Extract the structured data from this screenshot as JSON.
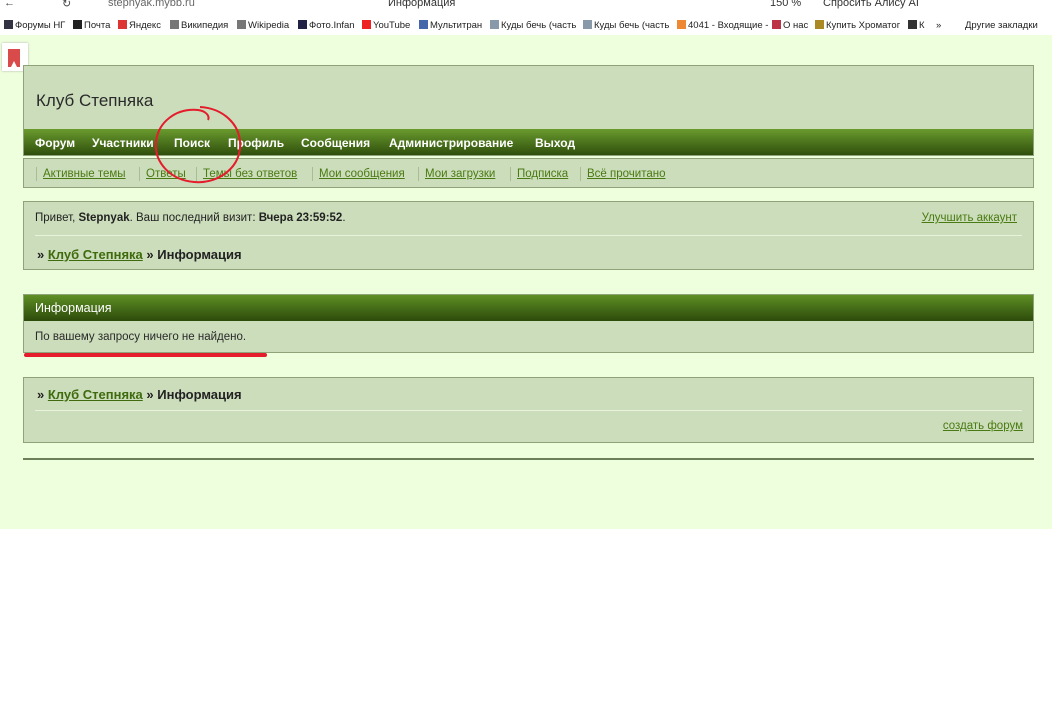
{
  "browser": {
    "url": "stepnyak.mybb.ru",
    "page_title": "Информация",
    "zoom": "150 %",
    "alice": "Спросить Алису AI",
    "bookmarks": [
      "Форумы НГ",
      "Почта",
      "Яндекс",
      "Википедия",
      "Wikipedia",
      "Фото.Infan",
      "YouTube",
      "Мультитран",
      "Куды бечь (часть",
      "Куды бечь (часть",
      "4041 - Входящие -",
      "О нас",
      "Купить Хроматог",
      "К"
    ],
    "other_bookmarks": "Другие закладки"
  },
  "forum": {
    "title": "Клуб Степняка",
    "nav": [
      "Форум",
      "Участники",
      "Поиск",
      "Профиль",
      "Сообщения",
      "Администрирование",
      "Выход"
    ],
    "subnav": [
      "Активные темы",
      "Ответы",
      "Темы без ответов",
      "Мои сообщения",
      "Мои загрузки",
      "Подписка",
      "Всё прочитано"
    ]
  },
  "welcome": {
    "prefix": "Привет,",
    "user": "Stepnyak",
    "mid": ".  Ваш последний визит:",
    "last_visit": "Вчера 23:59:52",
    "suffix": ".",
    "upgrade": "Улучшить аккаунт"
  },
  "breadcrumb": {
    "sep": "»",
    "home": "Клуб Степняка",
    "current": "Информация"
  },
  "info": {
    "heading": "Информация",
    "message": "По вашему запросу ничего не найдено."
  },
  "footer": {
    "create_forum": "создать форум"
  },
  "colors": {
    "page_bg": "#eeffdd",
    "panel_bg": "#ccddbb",
    "nav_dark": "#2f4f0c",
    "link": "#4a7a12",
    "annotation_red": "#e41c2c"
  }
}
